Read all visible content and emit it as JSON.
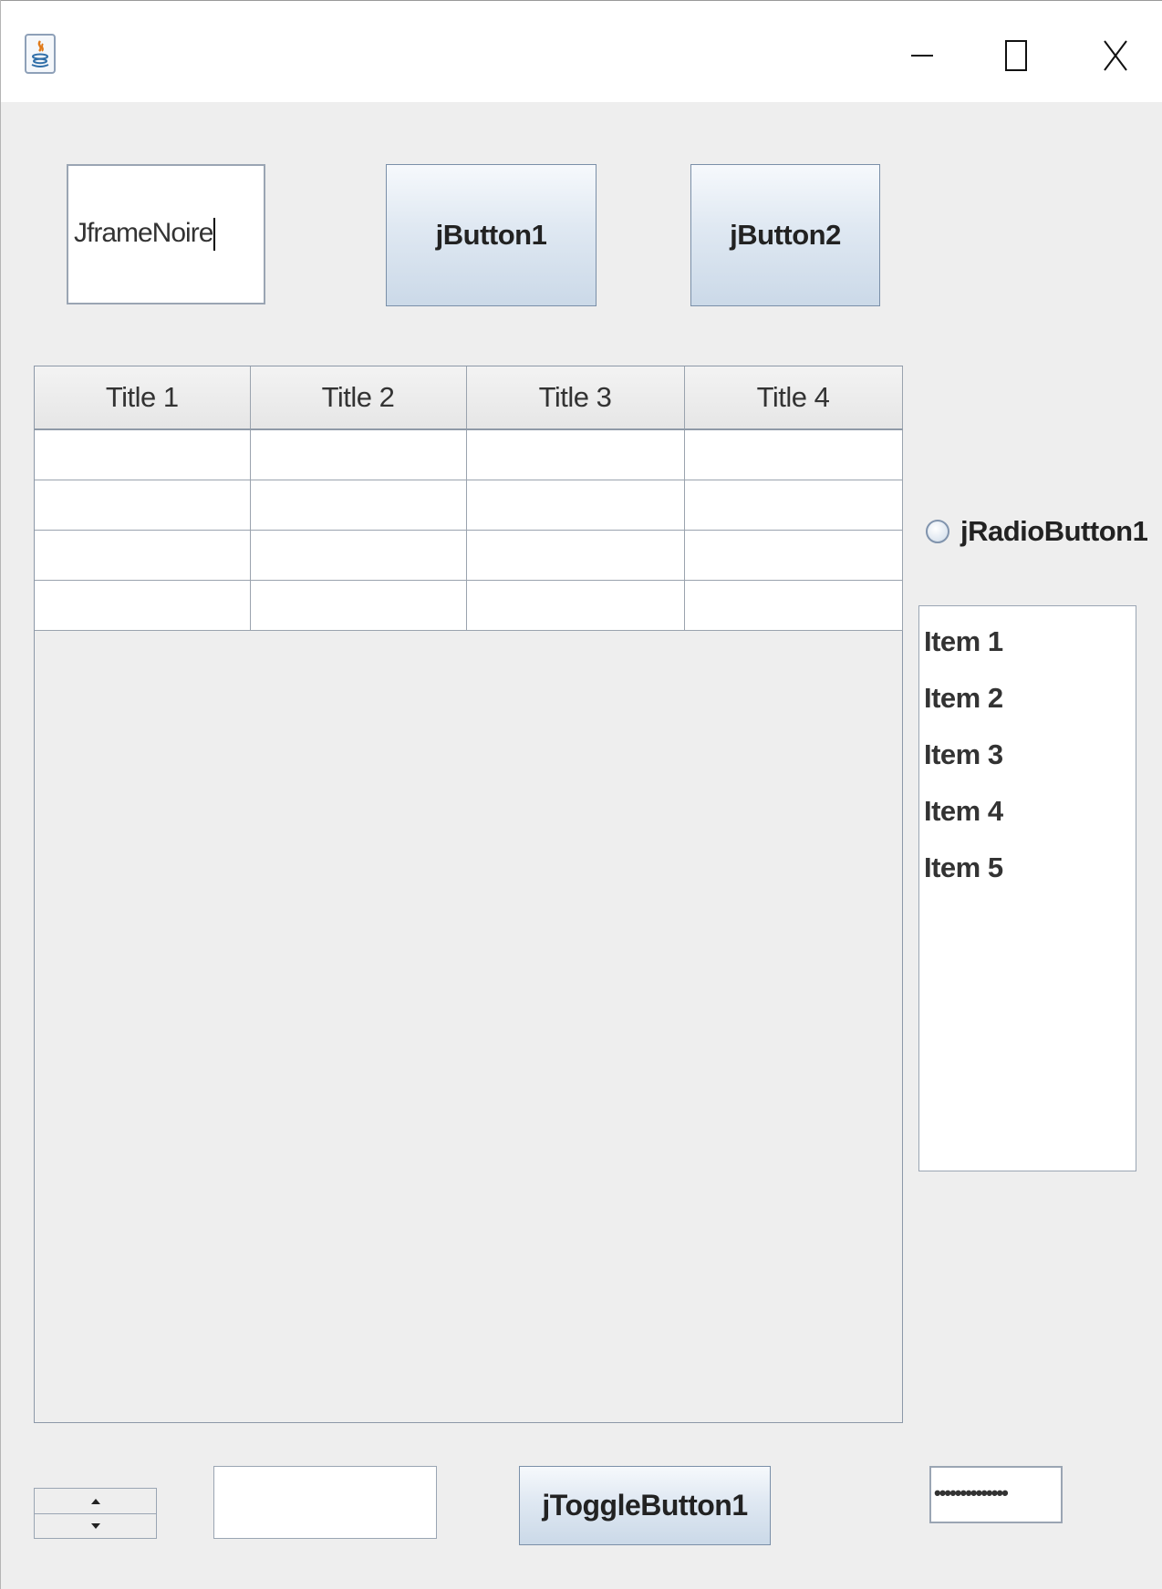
{
  "window": {
    "title": ""
  },
  "text_field_top": {
    "value": "JframeNoire"
  },
  "buttons": {
    "button1": "jButton1",
    "button2": "jButton2",
    "toggle": "jToggleButton1"
  },
  "table": {
    "columns": [
      "Title 1",
      "Title 2",
      "Title 3",
      "Title 4"
    ],
    "rows": [
      [
        "",
        "",
        "",
        ""
      ],
      [
        "",
        "",
        "",
        ""
      ],
      [
        "",
        "",
        "",
        ""
      ],
      [
        "",
        "",
        "",
        ""
      ]
    ]
  },
  "radio": {
    "label": "jRadioButton1",
    "selected": false
  },
  "list": {
    "items": [
      "Item 1",
      "Item 2",
      "Item 3",
      "Item 4",
      "Item 5"
    ]
  },
  "text_field_bottom": {
    "value": ""
  },
  "password_field": {
    "masked": "••••••••••••••"
  },
  "icons": {
    "app": "java-app-icon",
    "minimize": "minimize-icon",
    "maximize": "maximize-icon",
    "close": "close-icon",
    "spinner_up": "arrow-up-icon",
    "spinner_down": "arrow-down-icon"
  }
}
